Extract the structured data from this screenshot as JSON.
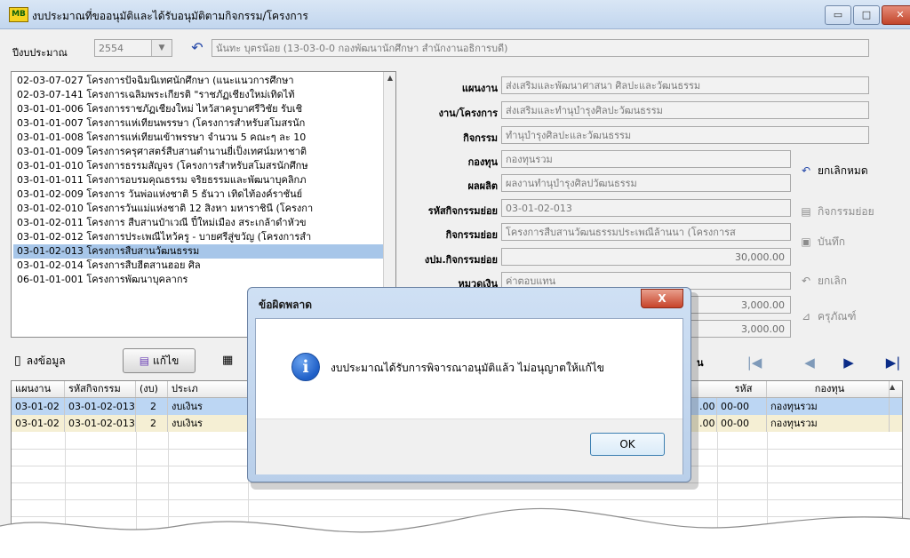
{
  "window": {
    "title": "งบประมาณที่ขออนุมัติและได้รับอนุมัติตามกิจกรรม/โครงการ",
    "logo_text": "MB",
    "minimize": "▭",
    "maximize": "□",
    "close": "✕"
  },
  "filter": {
    "year_label": "ปีงบประมาณ",
    "year_value": "2554",
    "user_value": "นันทะ บุตรน้อย (13-03-0-0 กองพัฒนานักศึกษา สำนักงานอธิการบดี)"
  },
  "project_list": [
    "02-03-07-027  โครงการปัจฉิมนิเทศนักศึกษา (แนะแนวการศึกษา",
    "02-03-07-141  โครงการเฉลิมพระเกียรติ \"ราชภัฏเชียงใหม่เทิดไท้",
    "03-01-01-006  โครงการราชภัฏเชียงใหม่ ไหว้สาครูบาศรีวิชัย รับเชิ",
    "03-01-01-007  โครงการแห่เทียนพรรษา (โครงการสำหรับสโมสรนัก",
    "03-01-01-008  โครงการแห่เทียนเข้าพรรษา จำนวน 5 คณะๆ ละ 10",
    "03-01-01-009  โครงการครุศาสตร์สืบสานตำนานยี่เป็งเทศน์มหาชาติ",
    "03-01-01-010  โครงการธรรมสัญจร (โครงการสำหรับสโมสรนักศึกษ",
    "03-01-01-011  โครงการอบรมคุณธรรม จริยธรรมและพัฒนาบุคลิกภ",
    "03-01-02-009  โครงการ วันพ่อแห่งชาติ 5 ธันวา เทิดไท้องค์ราชันย์",
    "03-01-02-010  โครงการวันแม่แห่งชาติ 12 สิงหา มหาราชินี (โครงกา",
    "03-01-02-011  โครงการ สืบสานป๋าเวณี ปี๋ใหม่เมือง สระเกล้าดำหัวข",
    "03-01-02-012  โครงการประเพณีไหว้ครู - บายศรีสู่ขวัญ (โครงการสำ",
    "03-01-02-013  โครงการสืบสานวัฒนธรรม",
    "03-01-02-014  โครงการสืบฮีตสานฮอย ศิล",
    "06-01-01-001  โครงการพัฒนาบุคลากร"
  ],
  "selected_index": 12,
  "details": [
    {
      "label": "แผนงาน",
      "value": "ส่งเสริมและพัฒนาศาสนา ศิลปะและวัฒนธรรม"
    },
    {
      "label": "งาน/โครงการ",
      "value": "ส่งเสริมและทำนุบำรุงศิลปะวัฒนธรรม"
    },
    {
      "label": "กิจกรรม",
      "value": "ทำนุบำรุงศิลปะและวัฒนธรรม"
    },
    {
      "label": "กองทุน",
      "value": "กองทุนรวม"
    },
    {
      "label": "ผลผลิต",
      "value": "ผลงานทำนุบำรุงศิลปวัฒนธรรม"
    },
    {
      "label": "รหัสกิจกรรมย่อย",
      "value": "03-01-02-013"
    },
    {
      "label": "กิจกรรมย่อย",
      "value": "โครงการสืบสานวัฒนธรรมประเพณีล้านนา (โครงการส"
    },
    {
      "label": "งปม.กิจกรรมย่อย",
      "value": "30,000.00"
    },
    {
      "label": "หมวดเงิน",
      "value": "ค่าตอบแทน"
    },
    {
      "label": "",
      "value": "3,000.00"
    },
    {
      "label": "",
      "value": "3,000.00"
    }
  ],
  "side_buttons": {
    "cancel_all": "ยกเลิกหมด",
    "sub_activity": "กิจกรรมย่อย",
    "save": "บันทึก",
    "cancel": "ยกเลิก",
    "durable": "ครุภัณฑ์"
  },
  "toolbar": {
    "add": "ลงข้อมูล",
    "edit": "แก้ไข",
    "fragment_label": "น"
  },
  "nav": {
    "first": "|◀",
    "prev": "◀",
    "next": "▶",
    "last": "▶|"
  },
  "grid": {
    "headers": [
      "แผนงาน",
      "รหัสกิจกรรม",
      "(งบ)",
      "ประเภ",
      "รหัส",
      "กองทุน"
    ],
    "rows": [
      {
        "plan": "03-01-02",
        "code": "03-01-02-013",
        "budget": "2",
        "type": "งบเงินร",
        "amount": ".00",
        "fcode": "00-00",
        "fund": "กองทุนรวม"
      },
      {
        "plan": "03-01-02",
        "code": "03-01-02-013",
        "budget": "2",
        "type": "งบเงินร",
        "amount": ".00",
        "fcode": "00-00",
        "fund": "กองทุนรวม"
      }
    ]
  },
  "dialog": {
    "title": "ข้อผิดพลาด",
    "message": "งบประมาณได้รับการพิจารณาอนุมัติแล้ว ไม่อนุญาตให้แก้ไข",
    "ok": "OK",
    "close": "X"
  },
  "colors": {
    "selected_row": "#a7c6e9",
    "dialog_frame": "#b9cfea",
    "close_red": "#c7432a"
  }
}
